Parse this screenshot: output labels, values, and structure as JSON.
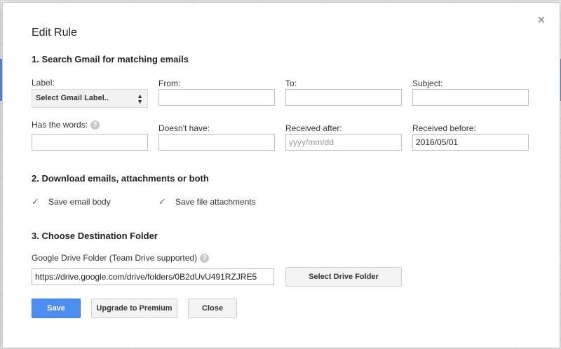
{
  "dialog": {
    "title": "Edit Rule",
    "close_glyph": "×"
  },
  "section1": {
    "heading": "1. Search Gmail for matching emails",
    "label_field": {
      "label": "Label:",
      "selected": "Select Gmail Label.."
    },
    "from_field": {
      "label": "From:",
      "value": ""
    },
    "to_field": {
      "label": "To:",
      "value": ""
    },
    "subject_field": {
      "label": "Subject:",
      "value": ""
    },
    "has_words_field": {
      "label": "Has the words:",
      "value": ""
    },
    "doesnt_have_field": {
      "label": "Doesn't have:",
      "value": ""
    },
    "received_after_field": {
      "label": "Received after:",
      "value": "",
      "placeholder": "yyyy/mm/dd"
    },
    "received_before_field": {
      "label": "Received before:",
      "value": "2016/05/01"
    }
  },
  "section2": {
    "heading": "2. Download emails, attachments or both",
    "save_body": {
      "label": "Save email body",
      "checked": true
    },
    "save_attachments": {
      "label": "Save file attachments",
      "checked": true
    }
  },
  "section3": {
    "heading": "3. Choose Destination Folder",
    "folder_label": "Google Drive Folder (Team Drive supported)",
    "folder_value": "https://drive.google.com/drive/folders/0B2dUvU491RZJRE5",
    "select_folder_button": "Select Drive Folder"
  },
  "footer": {
    "save": "Save",
    "upgrade": "Upgrade to Premium",
    "close": "Close"
  },
  "help_glyph": "?",
  "check_glyph": "✓",
  "colors": {
    "primary": "#4d8ef3"
  }
}
